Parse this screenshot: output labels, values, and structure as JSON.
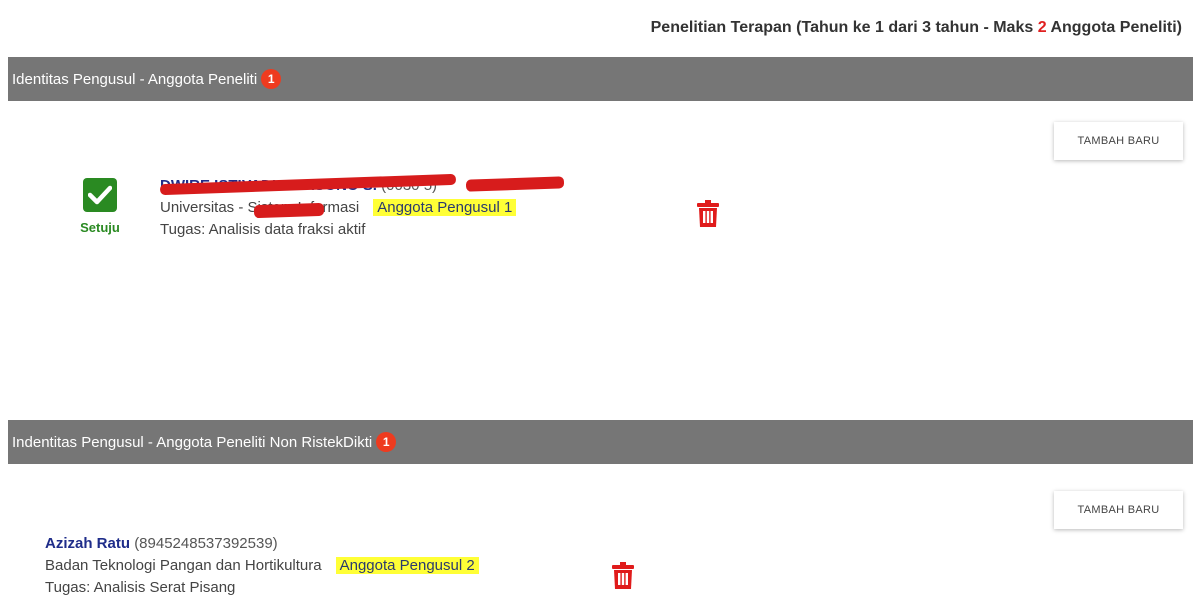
{
  "program_title": {
    "prefix": "Penelitian Terapan (Tahun ke 1 dari 3 tahun - Maks ",
    "max_count": "2",
    "suffix": " Anggota Peneliti)"
  },
  "section1": {
    "title": "Identitas Pengusul - Anggota Peneliti",
    "count": "1",
    "add_label": "TAMBAH BARU",
    "member": {
      "approval_status": "Setuju",
      "name": "DWIRE  ISTIYADI SWASONO S.",
      "nidn": "(0030   5)",
      "institution": "Universitas       - Sistem Informasi",
      "role": "Anggota Pengusul 1",
      "task": "Tugas: Analisis data fraksi aktif"
    }
  },
  "section2": {
    "title": "Indentitas Pengusul - Anggota Peneliti Non RistekDikti",
    "count": "1",
    "add_label": "TAMBAH BARU",
    "member": {
      "name": "Azizah Ratu",
      "nidn": "(8945248537392539)",
      "institution": "Badan Teknologi Pangan dan Hortikultura",
      "role": "Anggota Pengusul 2",
      "task": "Tugas: Analisis Serat Pisang"
    }
  },
  "icons": {
    "approve": "check-square-icon",
    "delete": "trash-icon"
  },
  "colors": {
    "header_bg": "#767676",
    "badge": "#ee3b1f",
    "approve_green": "#2a8a22",
    "role_highlight": "#ffff36",
    "trash_red": "#e01b1b"
  }
}
